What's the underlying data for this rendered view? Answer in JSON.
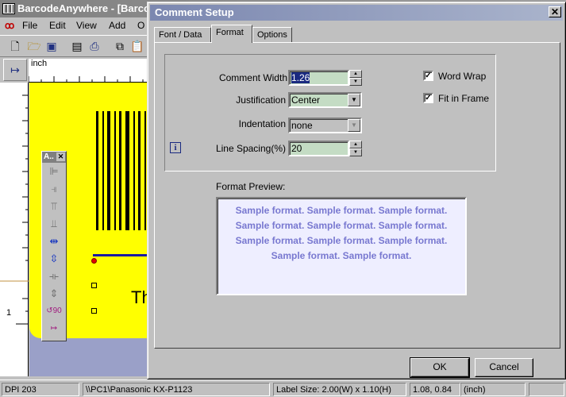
{
  "app": {
    "title": "BarcodeAnywhere - [Barcod",
    "menu": [
      "File",
      "Edit",
      "View",
      "Add",
      "O"
    ],
    "ruler_unit": "inch",
    "ruler_mark": "1",
    "canvas_text": "Th",
    "palette_title": "A..",
    "status": {
      "dpi": "DPI 203",
      "printer": "\\\\PC1\\Panasonic KX-P1123",
      "label_size": "Label Size:   2.00(W) x 1.10(H)",
      "coords": "1.08, 0.84",
      "unit": "(inch)"
    }
  },
  "dialog": {
    "title": "Comment Setup",
    "close_glyph": "✕",
    "tabs": [
      {
        "label": "Font / Data",
        "active": false
      },
      {
        "label": "Format",
        "active": true
      },
      {
        "label": "Options",
        "active": false
      }
    ],
    "fields": {
      "comment_width": {
        "label": "Comment Width",
        "value": "1.26"
      },
      "justification": {
        "label": "Justification",
        "value": "Center"
      },
      "indentation": {
        "label": "Indentation",
        "value": "none"
      },
      "line_spacing": {
        "label": "Line Spacing(%)",
        "value": "20"
      }
    },
    "checkboxes": {
      "word_wrap": {
        "label": "Word Wrap",
        "checked": true
      },
      "fit_in_frame": {
        "label": "Fit in Frame",
        "checked": true
      }
    },
    "info_icon": "i",
    "preview_label": "Format Preview:",
    "preview_lines": [
      "Sample format. Sample format. Sample format.",
      "Sample format. Sample format. Sample format.",
      "Sample format. Sample format. Sample format.",
      "Sample format. Sample format."
    ],
    "ok_label": "OK",
    "cancel_label": "Cancel",
    "colors": {
      "title_bar": "#7b87b0",
      "field_bg": "#c4dcc4",
      "preview_text": "#7878d0",
      "label_bg": "#ffff00"
    }
  }
}
